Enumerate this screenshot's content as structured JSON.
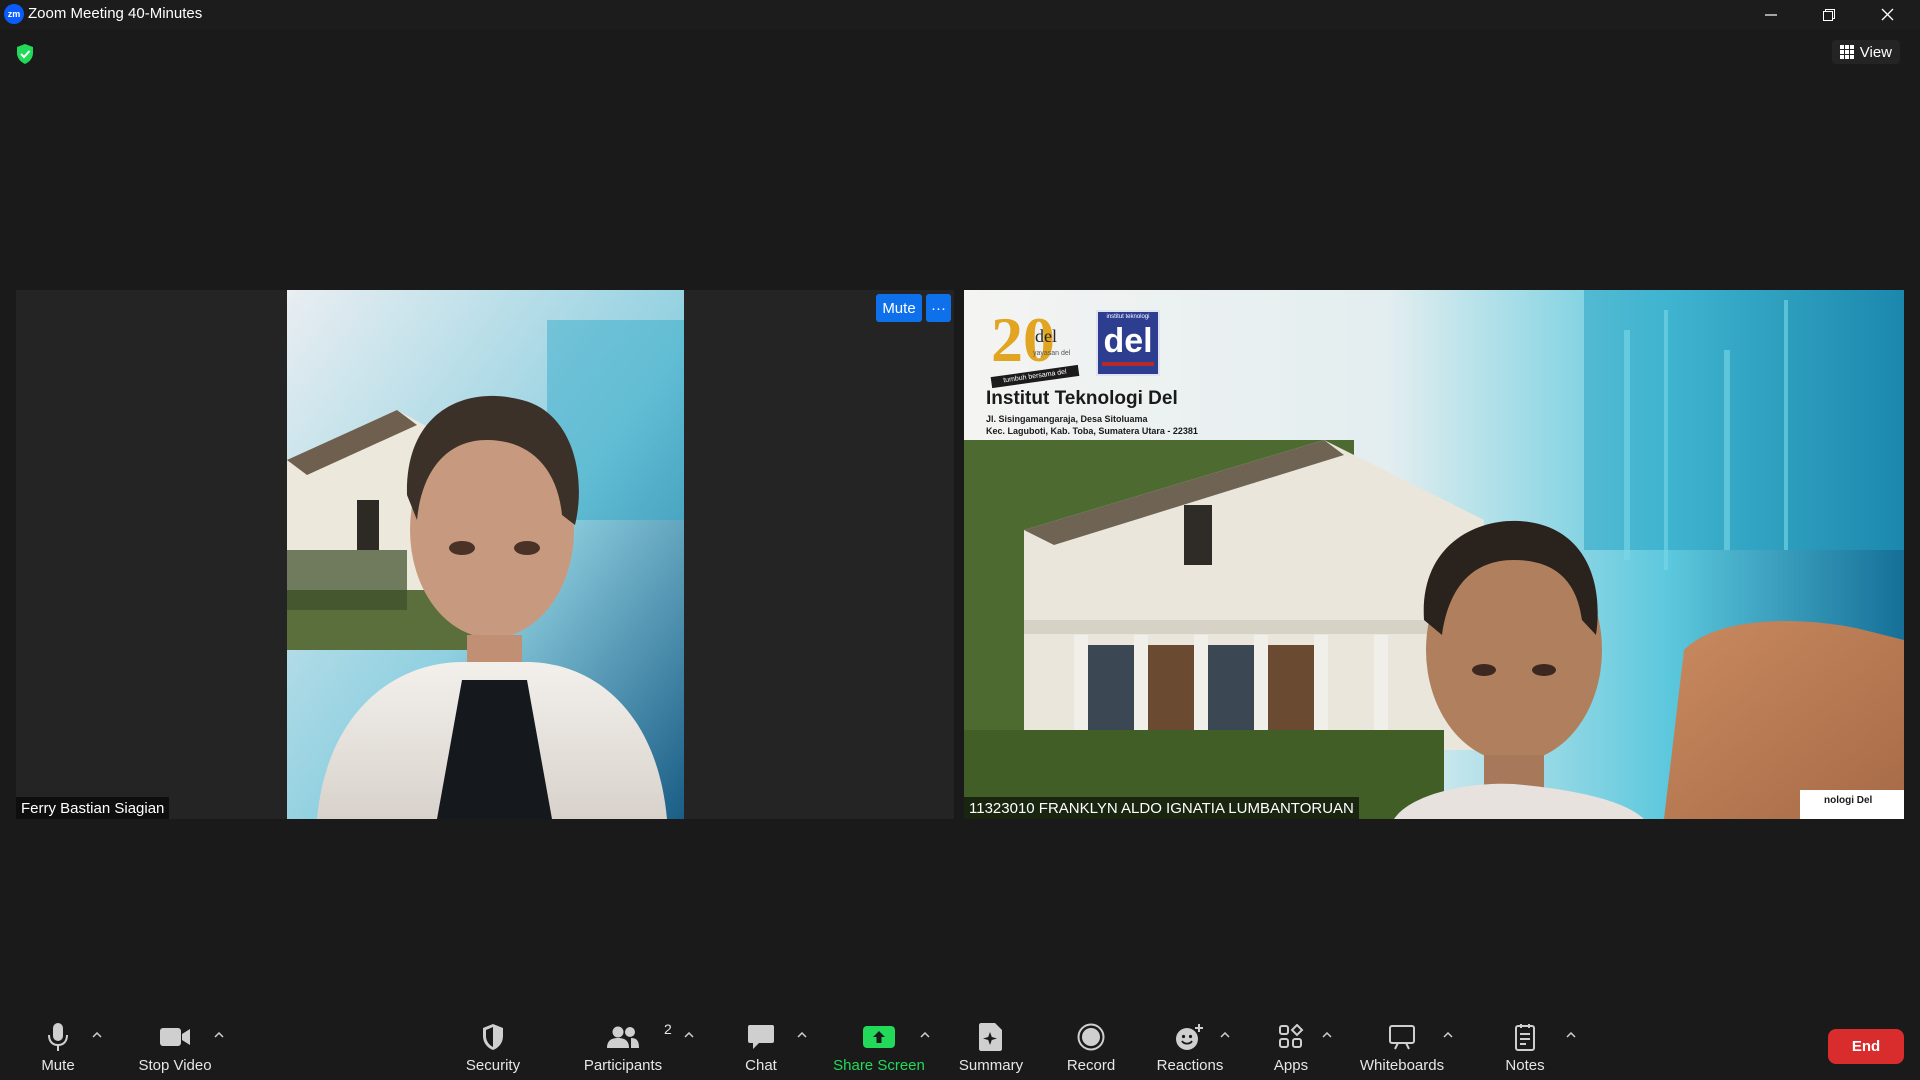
{
  "window": {
    "title": "Zoom Meeting 40-Minutes",
    "logo": "zm"
  },
  "top_bar": {
    "view_label": "View"
  },
  "participants": [
    {
      "name": "Ferry Bastian Siagian"
    },
    {
      "name": "11323010 FRANKLYN ALDO IGNATIA LUMBANTORUAN",
      "mute_label": "Mute",
      "more_label": "···"
    }
  ],
  "virtual_background": {
    "institution": "Institut Teknologi Del",
    "address_line1": "Jl. Sisingamangaraja, Desa Sitoluama",
    "address_line2": "Kec. Laguboti, Kab. Toba, Sumatera Utara - 22381",
    "anniversary_number": "20",
    "anniversary_logo_word": "del",
    "anniversary_logo_sub": "yayasan del",
    "anniversary_ribbon": "tumbuh bersama del",
    "del_logo_word": "del",
    "del_logo_top": "institut teknologi",
    "corner_caption": "nologi Del"
  },
  "toolbar": {
    "mute": "Mute",
    "stop_video": "Stop Video",
    "security": "Security",
    "participants": "Participants",
    "participants_count": "2",
    "chat": "Chat",
    "share_screen": "Share Screen",
    "summary": "Summary",
    "record": "Record",
    "reactions": "Reactions",
    "apps": "Apps",
    "whiteboards": "Whiteboards",
    "notes": "Notes",
    "end": "End"
  },
  "colors": {
    "share_green": "#23d959",
    "end_red": "#d92c2c",
    "accent_blue": "#0e71eb"
  }
}
